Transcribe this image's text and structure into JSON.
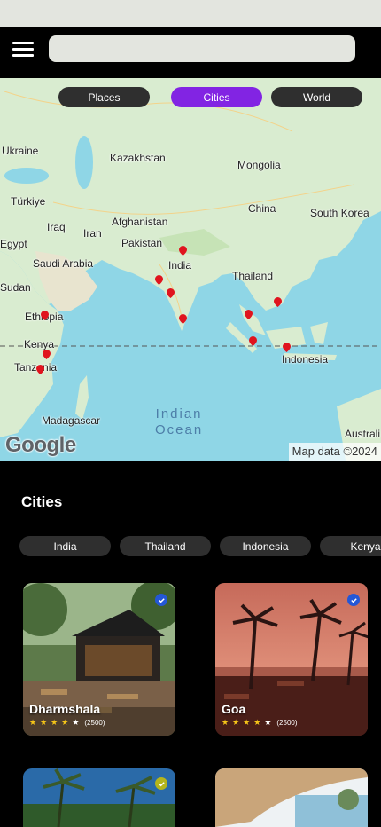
{
  "search": {
    "placeholder": ""
  },
  "map_tabs": [
    {
      "label": "Places",
      "active": false
    },
    {
      "label": "Cities",
      "active": true
    },
    {
      "label": "World",
      "active": false
    }
  ],
  "map": {
    "labels": {
      "ukraine": "Ukraine",
      "kazakhstan": "Kazakhstan",
      "mongolia": "Mongolia",
      "turkiye": "Türkiye",
      "iraq": "Iraq",
      "iran": "Iran",
      "afghanistan": "Afghanistan",
      "china": "China",
      "south_korea": "South Korea",
      "egypt": "Egypt",
      "pakistan": "Pakistan",
      "saudi_arabia": "Saudi Arabia",
      "india": "India",
      "sudan": "Sudan",
      "thailand": "Thailand",
      "ethiopia": "Ethiopia",
      "kenya": "Kenya",
      "tanzania": "Tanzania",
      "indonesia": "Indonesia",
      "madagascar": "Madagascar",
      "australia": "Australi",
      "indian_ocean_line1": "Indian",
      "indian_ocean_line2": "Ocean"
    },
    "logo": "Google",
    "attribution": "Map data ©2024",
    "pin_color": "#e0141e"
  },
  "section": {
    "title": "Cities"
  },
  "chips": [
    "India",
    "Thailand",
    "Indonesia",
    "Kenya"
  ],
  "cards": [
    {
      "name": "Dharmshala",
      "rating": 4,
      "count": "(2500)",
      "check_color": "#2457d6"
    },
    {
      "name": "Goa",
      "rating": 4,
      "count": "(2500)",
      "check_color": "#2457d6"
    },
    {
      "name": "",
      "rating": 0,
      "count": "",
      "check_color": "#b5b51c"
    },
    {
      "name": "",
      "rating": 0,
      "count": "",
      "check_color": ""
    }
  ],
  "colors": {
    "accent": "#8224e3",
    "chip_bg": "#2f2f2f",
    "ocean": "#8fd6e6",
    "land": "#d9ecd0"
  }
}
